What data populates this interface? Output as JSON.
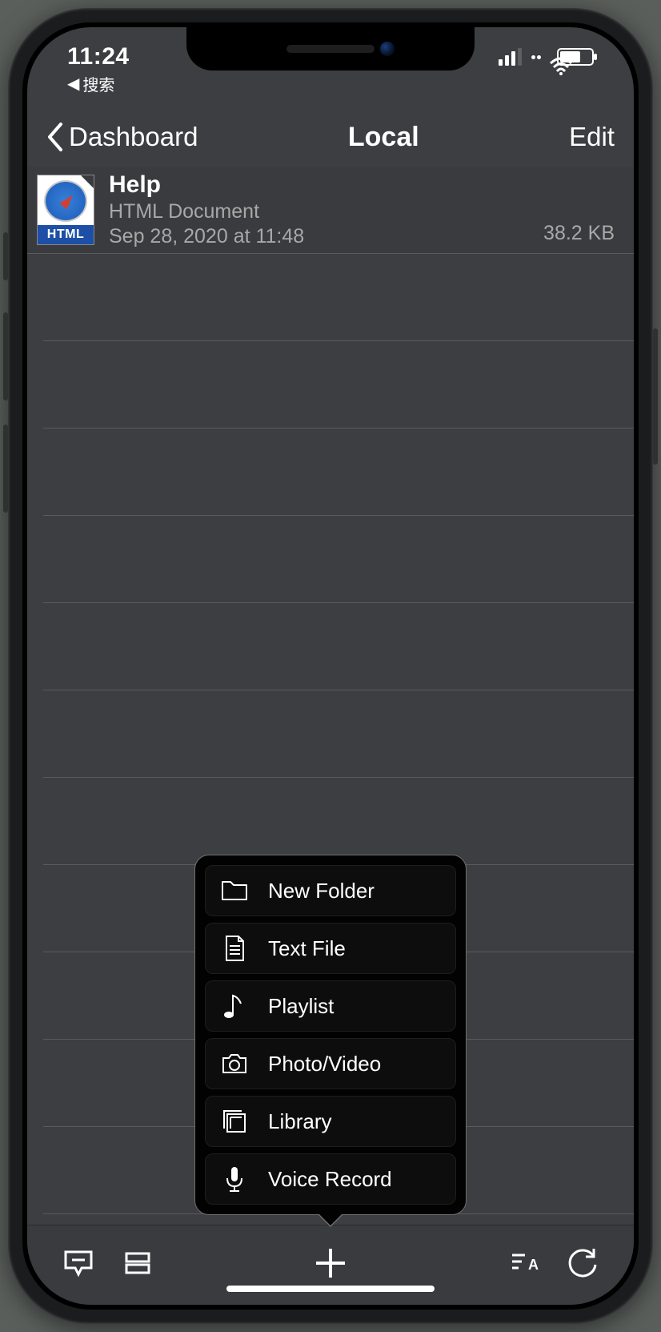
{
  "status": {
    "time": "11:24",
    "back_app": "搜索"
  },
  "nav": {
    "back_label": "Dashboard",
    "title": "Local",
    "edit_label": "Edit"
  },
  "file": {
    "name": "Help",
    "type": "HTML Document",
    "date": "Sep 28, 2020 at 11:48",
    "size": "38.2 KB",
    "icon_label": "HTML"
  },
  "popup": {
    "items": [
      {
        "label": "New Folder"
      },
      {
        "label": "Text File"
      },
      {
        "label": "Playlist"
      },
      {
        "label": "Photo/Video"
      },
      {
        "label": "Library"
      },
      {
        "label": "Voice Record"
      }
    ]
  }
}
